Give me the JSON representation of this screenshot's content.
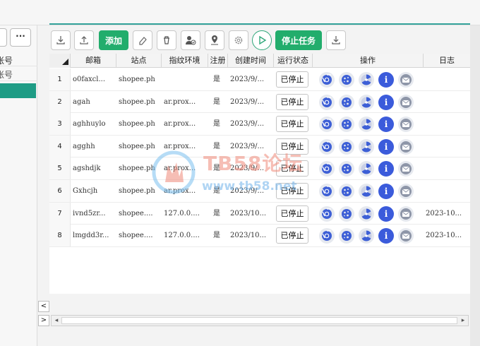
{
  "left_panel": {
    "more_label": "···",
    "row1_label": "账号",
    "row2_label": "账号"
  },
  "toolbar": {
    "add_label": "添加",
    "stop_task_label": "停止任务"
  },
  "table": {
    "columns": [
      "邮箱",
      "站点",
      "指纹环境",
      "注册",
      "创建时间",
      "运行状态",
      "操作",
      "日志"
    ],
    "rows": [
      {
        "num": "1",
        "email": "o0faxcl...",
        "site": "shopee.ph",
        "env": "",
        "reg": "是",
        "created": "2023/9/...",
        "status": "已停止",
        "log": ""
      },
      {
        "num": "2",
        "email": "agah",
        "site": "shopee.ph",
        "env": "ar.prox...",
        "reg": "是",
        "created": "2023/9/...",
        "status": "已停止",
        "log": ""
      },
      {
        "num": "3",
        "email": "aghhuylo",
        "site": "shopee.ph",
        "env": "ar.prox...",
        "reg": "是",
        "created": "2023/9/...",
        "status": "已停止",
        "log": ""
      },
      {
        "num": "4",
        "email": "agghh",
        "site": "shopee.ph",
        "env": "ar.prox...",
        "reg": "是",
        "created": "2023/9/...",
        "status": "已停止",
        "log": ""
      },
      {
        "num": "5",
        "email": "agshdjk",
        "site": "shopee.ph",
        "env": "ar.prox...",
        "reg": "是",
        "created": "2023/9/...",
        "status": "已停止",
        "log": ""
      },
      {
        "num": "6",
        "email": "Gxhcjh",
        "site": "shopee.ph",
        "env": "ar.prox...",
        "reg": "是",
        "created": "2023/9/...",
        "status": "已停止",
        "log": ""
      },
      {
        "num": "7",
        "email": "ivnd5zr...",
        "site": "shopee....",
        "env": "127.0.0....",
        "reg": "是",
        "created": "2023/10...",
        "status": "已停止",
        "log": "2023-10..."
      },
      {
        "num": "8",
        "email": "lmgdd3r...",
        "site": "shopee....",
        "env": "127.0.0....",
        "reg": "是",
        "created": "2023/10...",
        "status": "已停止",
        "log": "2023-10..."
      }
    ],
    "op_icons": [
      "chrome-icon",
      "cookie-icon",
      "fan-icon",
      "info-icon",
      "mail-icon"
    ],
    "info_glyph": "i"
  },
  "watermark": {
    "title": "TB58论坛",
    "url": "www.tb58.net"
  },
  "scroll": {
    "left_arrow": "<",
    "right_arrow": ">"
  },
  "colors": {
    "accent_green": "#22ad6c",
    "teal": "#1e9c85",
    "info_blue": "#3b5bdb"
  }
}
